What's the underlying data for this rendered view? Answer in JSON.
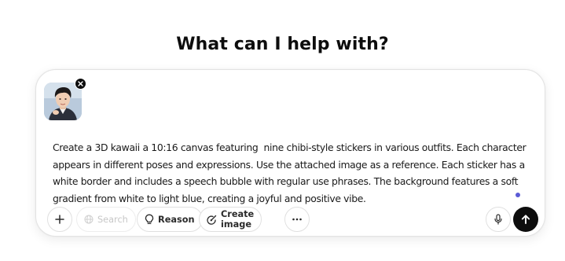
{
  "page": {
    "heading": "What can I help with?"
  },
  "composer": {
    "prompt_text": "Create a 3D kawaii a 10:16 canvas featuring  nine chibi-style stickers in various outfits. Each character appears in different poses and expressions. Use the attached image as a reference. Each sticker has a white border and includes a speech bubble with regular use phrases. The background features a soft gradient from white to light blue, creating a joyful and positive vibe.",
    "attachment": {
      "icon": "image-thumbnail",
      "remove_icon": "close-icon"
    },
    "toolbar": {
      "add_icon": "plus-icon",
      "search_label": "Search",
      "search_icon": "globe-icon",
      "search_disabled": true,
      "reason_label": "Reason",
      "reason_icon": "lightbulb-icon",
      "create_image_label": "Create image",
      "create_image_icon": "paint-brush-icon",
      "more_icon": "ellipsis-icon",
      "mic_icon": "microphone-icon",
      "send_icon": "arrow-up-icon"
    },
    "colors": {
      "send": "#0d0d0d",
      "status_dot": "#5b5bd6",
      "border": "#e3e3e3"
    }
  }
}
